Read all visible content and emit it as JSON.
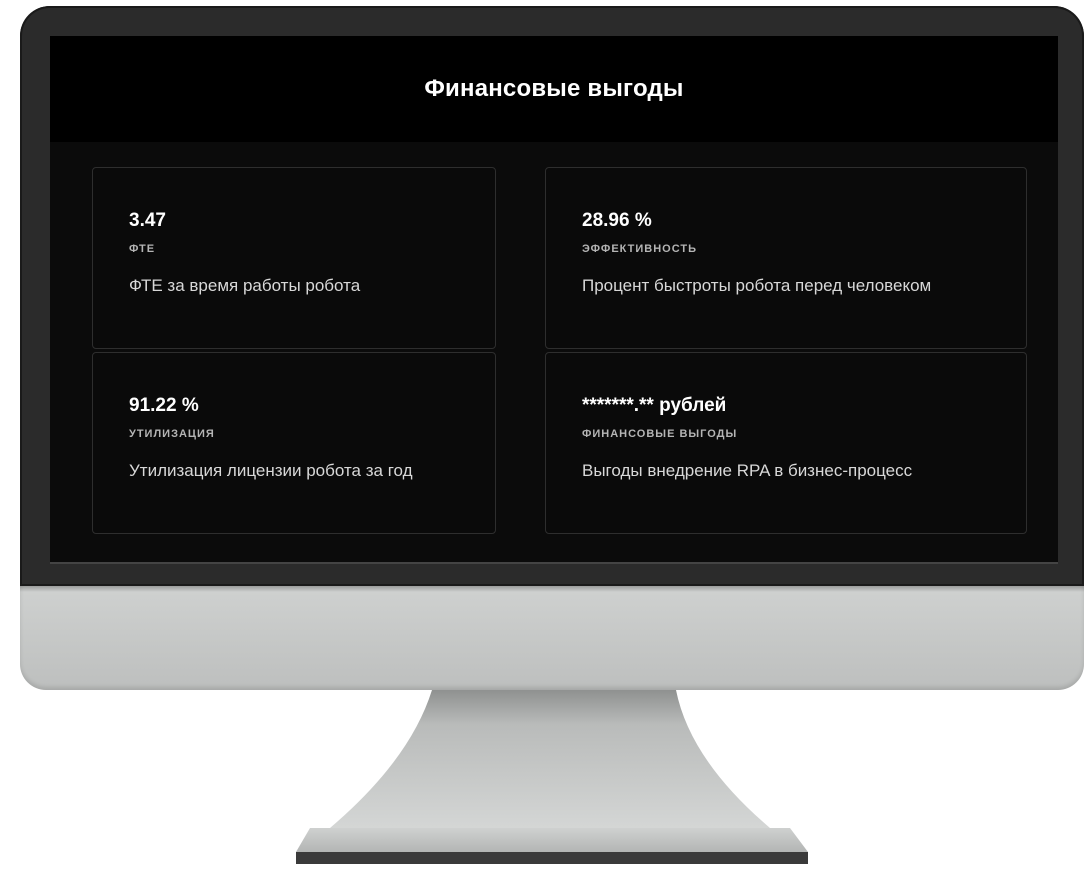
{
  "header": {
    "title": "Финансовые выгоды"
  },
  "cards": [
    {
      "value": "3.47",
      "label": "ФТЕ",
      "description": "ФТЕ за время работы робота"
    },
    {
      "value": "28.96 %",
      "label": "ЭФФЕКТИВНОСТЬ",
      "description": "Процент быстроты робота перед человеком"
    },
    {
      "value": "91.22 %",
      "label": "УТИЛИЗАЦИЯ",
      "description": "Утилизация лицензии робота за год"
    },
    {
      "value": "*******.** рублей",
      "label": "ФИНАНСОВЫЕ ВЫГОДЫ",
      "description": "Выгоды внедрение RPA в бизнес-процесс"
    }
  ],
  "colors": {
    "screen_background": "#0b0b0b",
    "header_background": "#000000",
    "card_border": "#2e2e2e",
    "text_primary": "#ffffff",
    "text_label": "#b5b5b5",
    "monitor_frame": "#2b2b2b",
    "monitor_chin": "#c8cac9"
  }
}
